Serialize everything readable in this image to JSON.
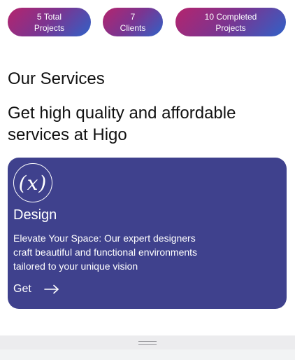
{
  "stats": [
    {
      "line1": "5 Total",
      "line2": "Projects"
    },
    {
      "line1": "7",
      "line2": "Clients"
    },
    {
      "line1": "10 Completed",
      "line2": "Projects"
    }
  ],
  "section": {
    "title": "Our Services",
    "subtitle": "Get high quality and affordable services at Higo"
  },
  "service_card": {
    "icon": "function-x-icon",
    "icon_glyph": "(x)",
    "title": "Design",
    "description": "Elevate Your Space: Our expert designers craft beautiful and functional environments tailored to your unique vision",
    "link_label": "Get",
    "link_icon": "arrow-right-icon",
    "background": "#3f418d"
  },
  "colors": {
    "pill_gradient_start": "#b5246d",
    "pill_gradient_end": "#2f62c8",
    "text": "#111111"
  }
}
